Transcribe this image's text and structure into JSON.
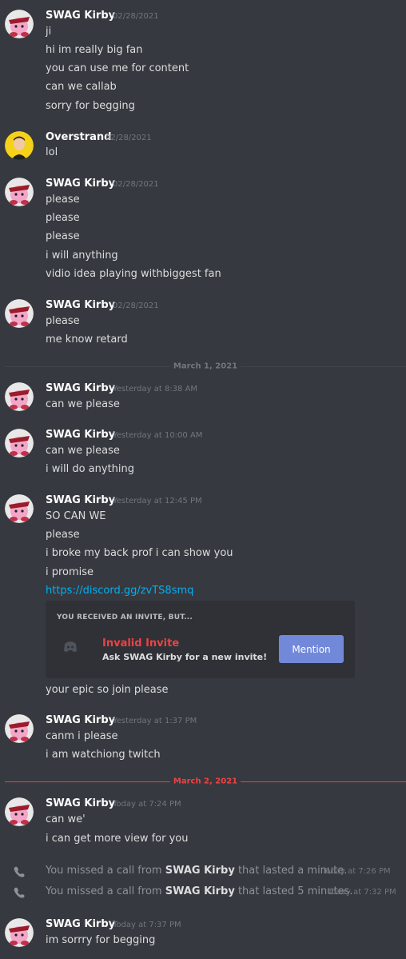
{
  "users": {
    "swag": "SWAG Kirby",
    "over": "Overstrand"
  },
  "messages": [
    {
      "user": "SWAG Kirby",
      "time": "02/28/2021",
      "lines": [
        "ji",
        "hi im really big fan",
        "you can use me for content",
        "can we callab",
        "sorry for begging"
      ]
    },
    {
      "user": "Overstrand",
      "time": "02/28/2021",
      "lines": [
        "lol"
      ]
    },
    {
      "user": "SWAG Kirby",
      "time": "02/28/2021",
      "lines": [
        "please",
        "please",
        "please",
        "i will anything",
        "vidio idea playing withbiggest fan"
      ]
    },
    {
      "user": "SWAG Kirby",
      "time": "02/28/2021",
      "lines": [
        "please",
        "me know retard"
      ]
    },
    {
      "user": "SWAG Kirby",
      "time": "Yesterday at 8:38 AM",
      "lines": [
        "can we please"
      ]
    },
    {
      "user": "SWAG Kirby",
      "time": "Yesterday at 10:00 AM",
      "lines": [
        "can we please",
        "i will do anything"
      ]
    },
    {
      "user": "SWAG Kirby",
      "time": "Yesterday at 12:45 PM",
      "lines": [
        "SO CAN WE",
        "please",
        "i broke my back prof i can show you",
        "i promise",
        "https://discord.gg/zvTS8smq",
        "your epic so join please"
      ]
    },
    {
      "user": "SWAG Kirby",
      "time": "Yesterday at 1:37 PM",
      "lines": [
        "canm i please",
        "i am watchiong twitch"
      ]
    },
    {
      "user": "SWAG Kirby",
      "time": "Today at 7:24 PM",
      "lines": [
        "can we'",
        "i can get more view for you"
      ]
    },
    {
      "user": "SWAG Kirby",
      "time": "Today at 7:37 PM",
      "lines": [
        "im sorrry for begging"
      ]
    }
  ],
  "dividers": {
    "d1": "March 1, 2021",
    "d2": "March 2, 2021"
  },
  "invite": {
    "header": "YOU RECEIVED AN INVITE, BUT...",
    "title": "Invalid Invite",
    "subtitle": "Ask SWAG Kirby for a new invite!",
    "button": "Mention"
  },
  "calls": [
    {
      "prefix": "You missed a call from ",
      "user": "SWAG Kirby",
      "suffix": " that lasted a minute.",
      "time": "Today at 7:26 PM"
    },
    {
      "prefix": "You missed a call from ",
      "user": "SWAG Kirby",
      "suffix": " that lasted 5 minutes.",
      "time": "Today at 7:32 PM"
    }
  ],
  "colors": {
    "background": "#36393f",
    "link": "#00b0f4",
    "new_divider": "#ed4245",
    "button": "#7289da"
  },
  "icons": {
    "avatar_swag": "kirby-with-cap-avatar",
    "avatar_over": "person-yellow-avatar",
    "call": "phone-icon",
    "invite": "discord-grey-icon"
  }
}
